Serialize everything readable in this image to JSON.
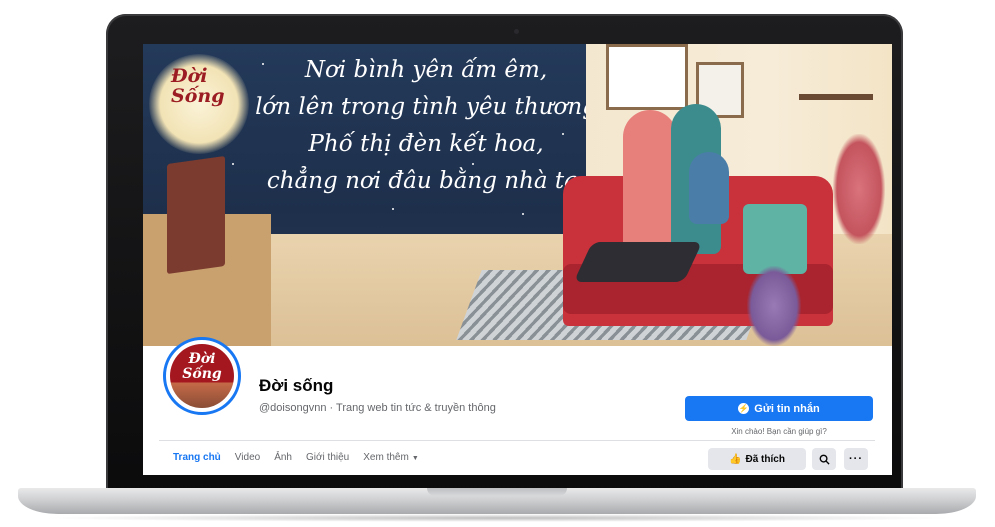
{
  "cover": {
    "logo_line1": "Đời",
    "logo_line2": "Sống",
    "poem": [
      "Nơi bình yên ấm êm,",
      "lớn lên trong tình yêu thương",
      "Phố thị đèn kết hoa,",
      "chẳng nơi đâu bằng nhà ta."
    ]
  },
  "profile": {
    "avatar_line1": "Đời",
    "avatar_line2": "Sống",
    "name": "Đời sống",
    "subtitle": "@doisongvnn · Trang web tin tức & truyền thông",
    "message_button": "Gửi tin nhắn",
    "greeting": "Xin chào! Bạn cần giúp gì?",
    "liked_button": "Đã thích"
  },
  "tabs": [
    {
      "label": "Trang chủ",
      "active": true
    },
    {
      "label": "Video"
    },
    {
      "label": "Ảnh"
    },
    {
      "label": "Giới thiệu"
    },
    {
      "label": "Xem thêm"
    }
  ],
  "icons": {
    "messenger": "messenger-icon",
    "like": "thumbs-up-icon",
    "search": "search-icon",
    "more": "more-icon",
    "caret": "caret-down-icon"
  },
  "colors": {
    "accent": "#1877f2",
    "cover_sky": "#243a5a",
    "brand_red": "#a5171f"
  }
}
